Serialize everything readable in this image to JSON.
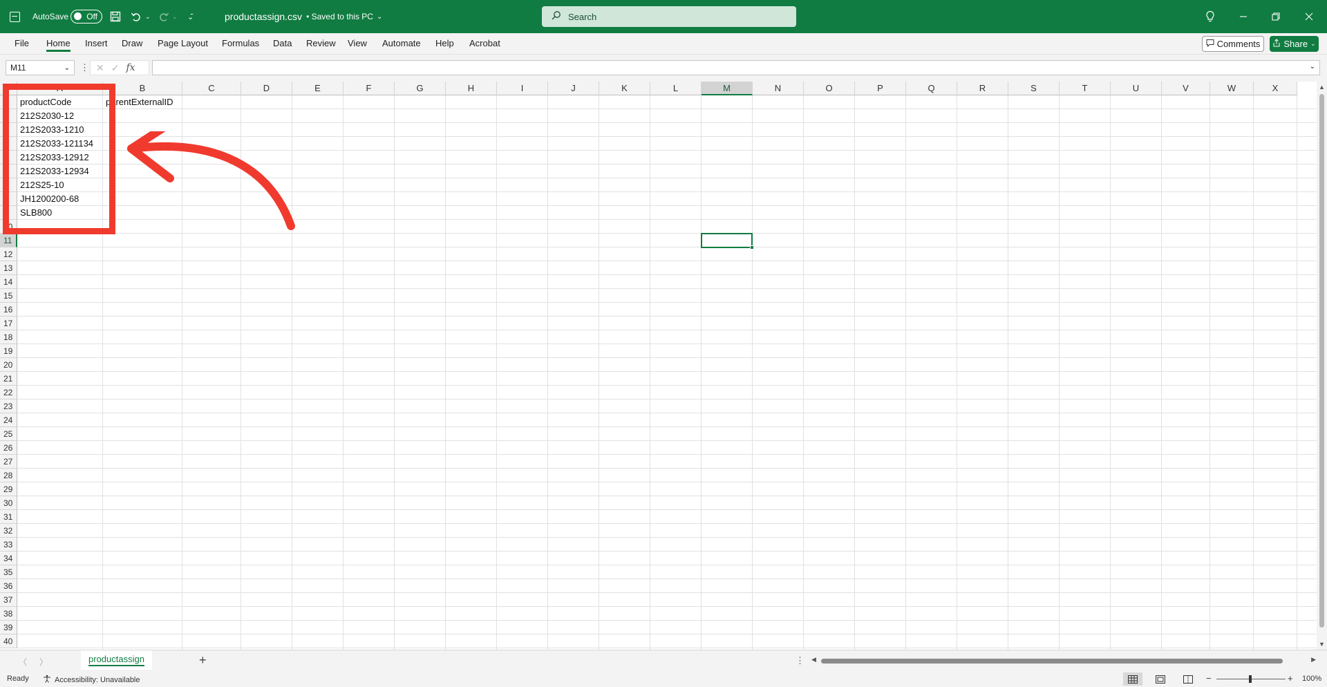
{
  "titlebar": {
    "autosave_label": "AutoSave",
    "autosave_state": "Off",
    "doc_name": "productassign.csv",
    "doc_status": "• Saved to this PC",
    "search_placeholder": "Search"
  },
  "menu": {
    "items": [
      "File",
      "Home",
      "Insert",
      "Draw",
      "Page Layout",
      "Formulas",
      "Data",
      "Review",
      "View",
      "Automate",
      "Help",
      "Acrobat"
    ],
    "active": "Home",
    "comments_label": "Comments",
    "share_label": "Share"
  },
  "formula_bar": {
    "name_box": "M11",
    "fx_label": "fx",
    "formula": ""
  },
  "sheet": {
    "columns": [
      "A",
      "B",
      "C",
      "D",
      "E",
      "F",
      "G",
      "H",
      "I",
      "J",
      "K",
      "L",
      "M",
      "N",
      "O",
      "P",
      "Q",
      "R",
      "S",
      "T",
      "U",
      "V",
      "W",
      "X"
    ],
    "selected_column": "M",
    "rows_visible": 40,
    "selected_row": 11,
    "cells": [
      {
        "ref": "A1",
        "value": "productCode"
      },
      {
        "ref": "B1",
        "value": "parentExternalID"
      },
      {
        "ref": "A2",
        "value": "212S2030-12"
      },
      {
        "ref": "A3",
        "value": "212S2033-1210"
      },
      {
        "ref": "A4",
        "value": "212S2033-121134"
      },
      {
        "ref": "A5",
        "value": "212S2033-12912"
      },
      {
        "ref": "A6",
        "value": "212S2033-12934"
      },
      {
        "ref": "A7",
        "value": "212S25-10"
      },
      {
        "ref": "A8",
        "value": "JH1200200-68"
      },
      {
        "ref": "A9",
        "value": "SLB800"
      }
    ],
    "active_cell": "M11"
  },
  "annotation": {
    "color": "#f03a2e"
  },
  "tabs": {
    "sheets": [
      "productassign"
    ],
    "active": "productassign"
  },
  "status": {
    "ready": "Ready",
    "accessibility": "Accessibility: Unavailable",
    "zoom": "100%"
  },
  "colors": {
    "brand": "#107c41"
  }
}
